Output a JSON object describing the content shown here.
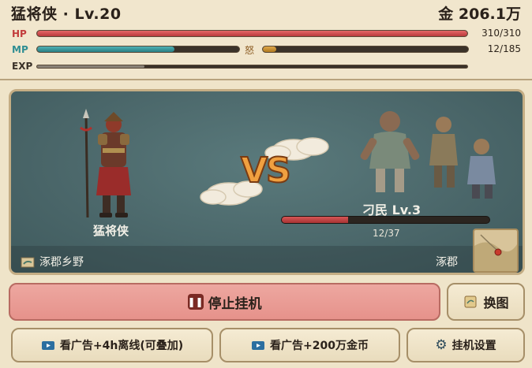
{
  "player": {
    "title": "猛将侠 · Lv.20",
    "gold": "金 206.1万"
  },
  "stats": {
    "hp": {
      "label": "HP",
      "text": "310/310",
      "fraction": 1.0
    },
    "mp": {
      "label": "MP",
      "fraction": 0.68
    },
    "rage": {
      "label": "怒",
      "text": "12/185",
      "fraction": 0.065
    },
    "exp": {
      "label": "EXP",
      "fraction": 0.25
    }
  },
  "battle": {
    "vs": "VS",
    "hero_name": "猛将侠",
    "enemy_name": "刁民 Lv.3",
    "enemy_hp_text": "12/37",
    "enemy_hp_fraction": 0.32,
    "location_left": "涿郡乡野",
    "location_right": "涿郡"
  },
  "buttons": {
    "stop": "停止挂机",
    "swap": "换图",
    "ad_offline": "看广告+4h离线(可叠加)",
    "ad_gold": "看广告+200万金币",
    "settings": "挂机设置"
  },
  "colors": {
    "hp": "#c8484a",
    "mp": "#2f8e93",
    "rage": "#c48a2c",
    "exp": "#7a6f62"
  }
}
